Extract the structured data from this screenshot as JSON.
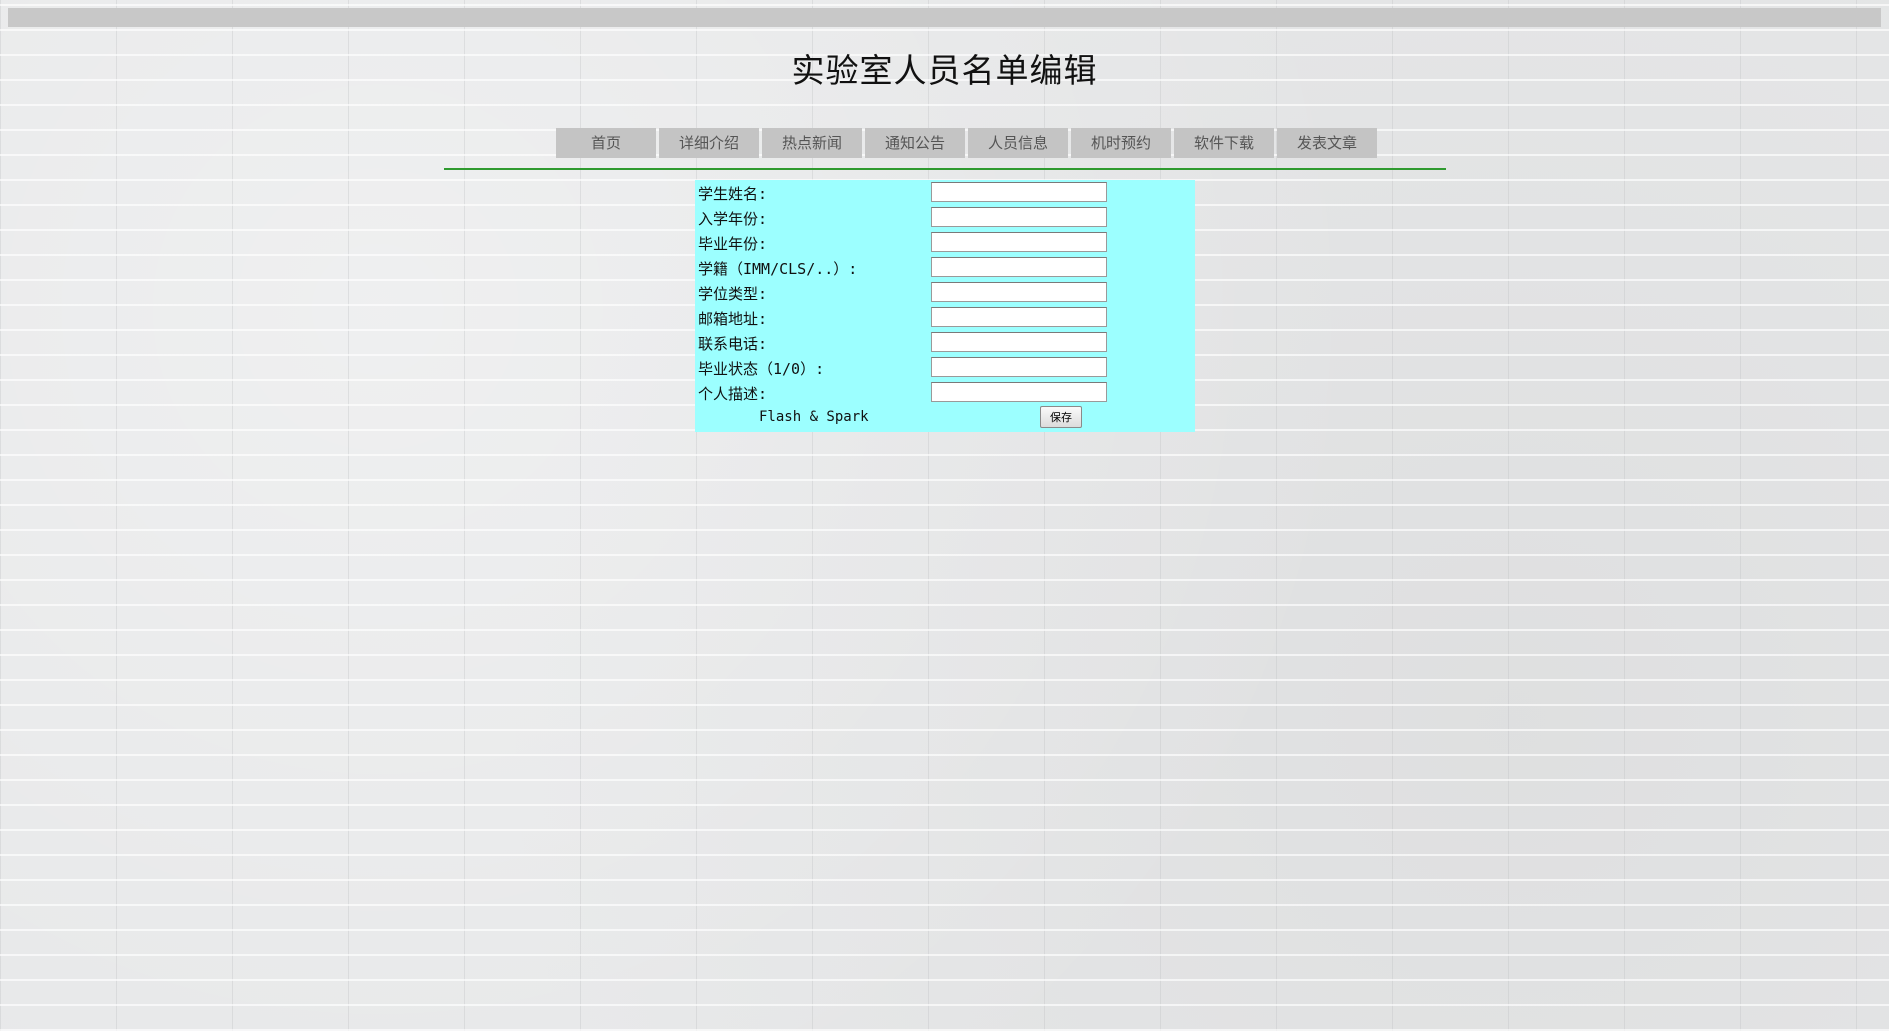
{
  "page": {
    "title": "实验室人员名单编辑"
  },
  "nav": {
    "items": [
      {
        "label": "首页"
      },
      {
        "label": "详细介绍"
      },
      {
        "label": "热点新闻"
      },
      {
        "label": "通知公告"
      },
      {
        "label": "人员信息"
      },
      {
        "label": "机时预约"
      },
      {
        "label": "软件下载"
      },
      {
        "label": "发表文章"
      }
    ]
  },
  "form": {
    "fields": [
      {
        "label": "学生姓名:",
        "value": "",
        "placeholder": ""
      },
      {
        "label": "入学年份:",
        "value": "",
        "placeholder": ""
      },
      {
        "label": "毕业年份:",
        "value": "",
        "placeholder": ""
      },
      {
        "label": "学籍（IMM/CLS/..）:",
        "value": "",
        "placeholder": ""
      },
      {
        "label": "学位类型:",
        "value": "",
        "placeholder": ""
      },
      {
        "label": "邮箱地址:",
        "value": "",
        "placeholder": ""
      },
      {
        "label": "联系电话:",
        "value": "",
        "placeholder": ""
      },
      {
        "label": "毕业状态（1/0）:",
        "value": "",
        "placeholder": ""
      },
      {
        "label": "个人描述:",
        "value": "",
        "placeholder": ""
      }
    ],
    "footer_text": "Flash & Spark",
    "save_label": "保存"
  },
  "colors": {
    "form_background": "#9cffff",
    "nav_background": "#c4c4c4",
    "divider": "#2f9a2f",
    "top_bar": "#c8c8c8"
  }
}
